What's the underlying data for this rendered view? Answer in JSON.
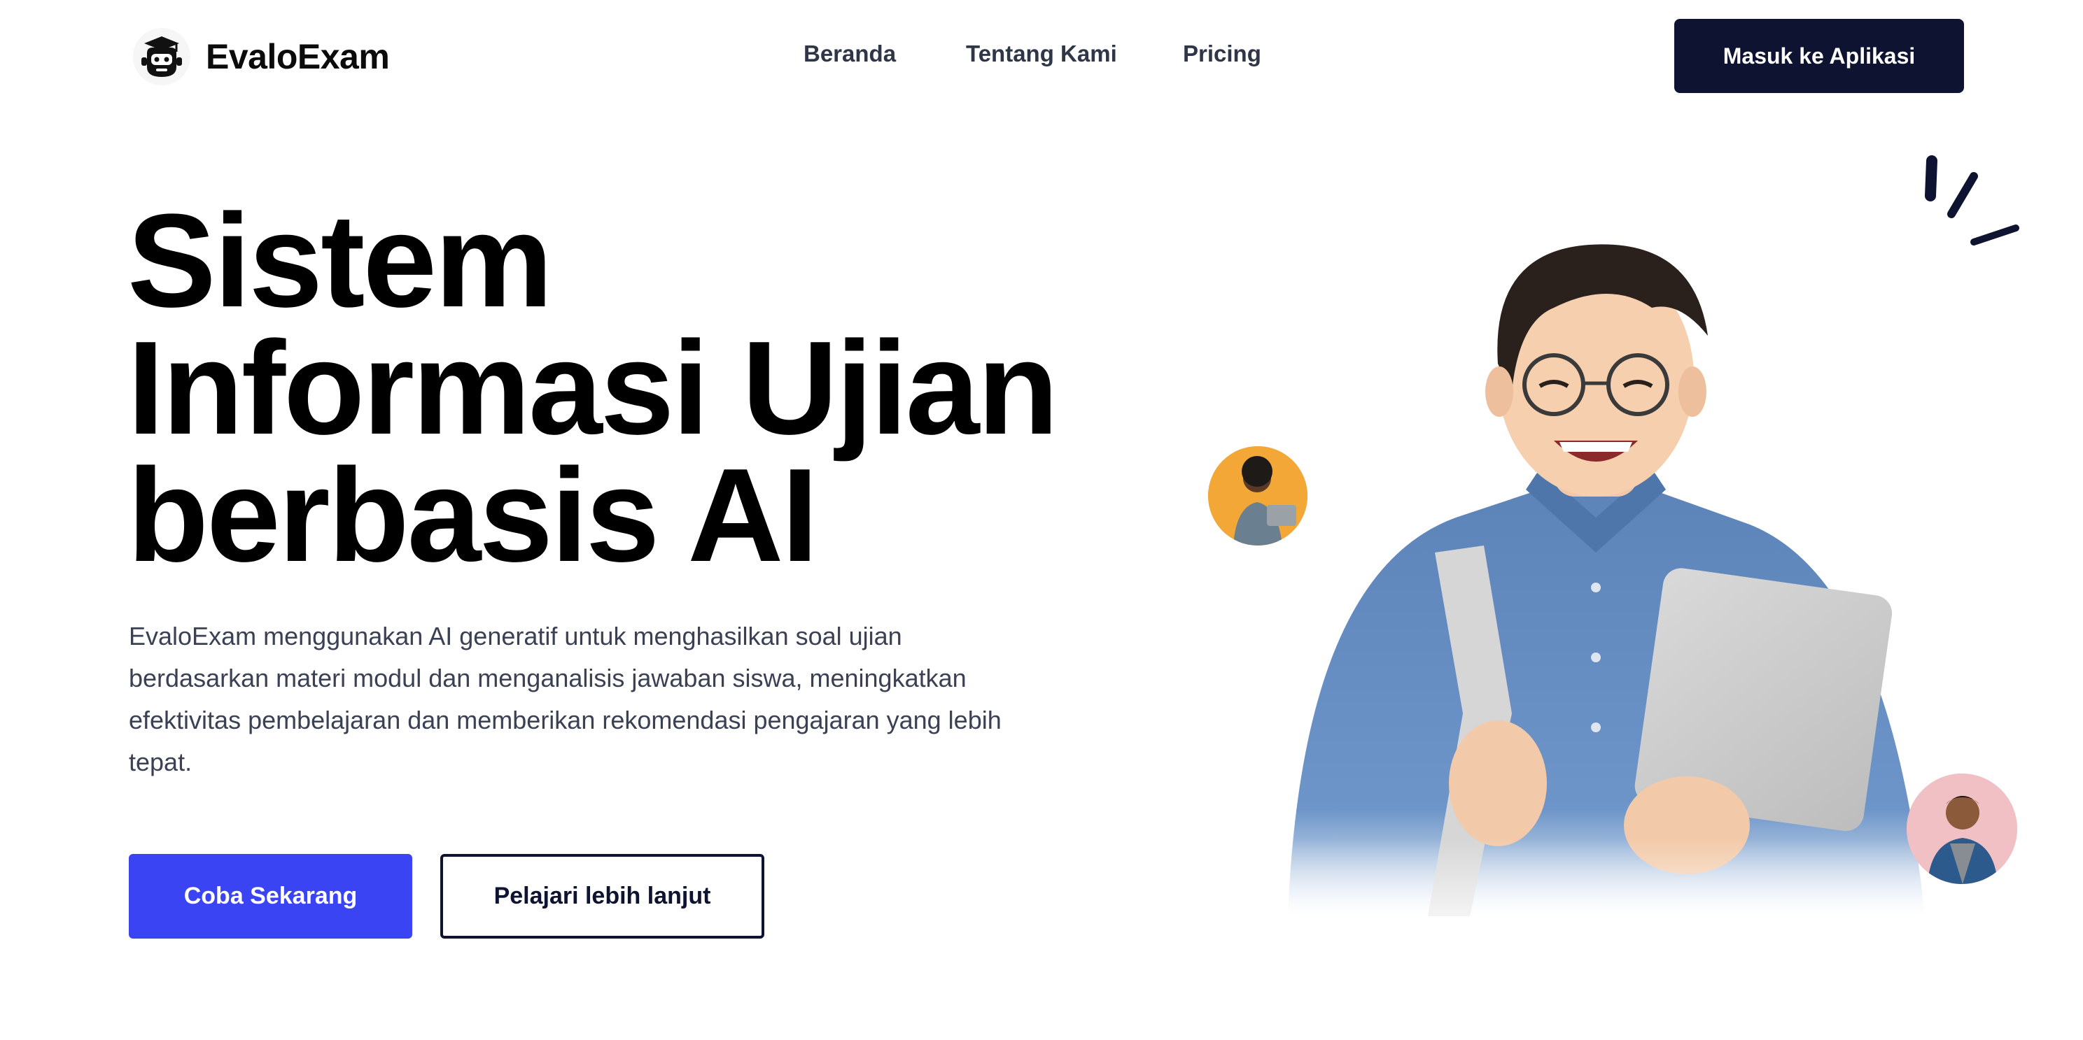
{
  "header": {
    "brand": "EvaloExam",
    "nav": [
      {
        "label": "Beranda"
      },
      {
        "label": "Tentang Kami"
      },
      {
        "label": "Pricing"
      }
    ],
    "cta_label": "Masuk ke Aplikasi"
  },
  "hero": {
    "title_lines": [
      "Sistem",
      "Informasi Ujian",
      "berbasis AI"
    ],
    "description": "EvaloExam menggunakan AI generatif untuk menghasilkan soal ujian berdasarkan materi modul dan menganalisis jawaban siswa, meningkatkan efektivitas pembelajaran dan memberikan rekomendasi pengajaran yang lebih tepat.",
    "primary_button": "Coba Sekarang",
    "secondary_button": "Pelajari lebih lanjut"
  },
  "icons": {
    "logo": "graduation-robot-icon",
    "sparkle": "sparkle-lines-icon"
  },
  "colors": {
    "primary": "#3a44f2",
    "dark": "#0d1330",
    "text_muted": "#3a4154"
  }
}
